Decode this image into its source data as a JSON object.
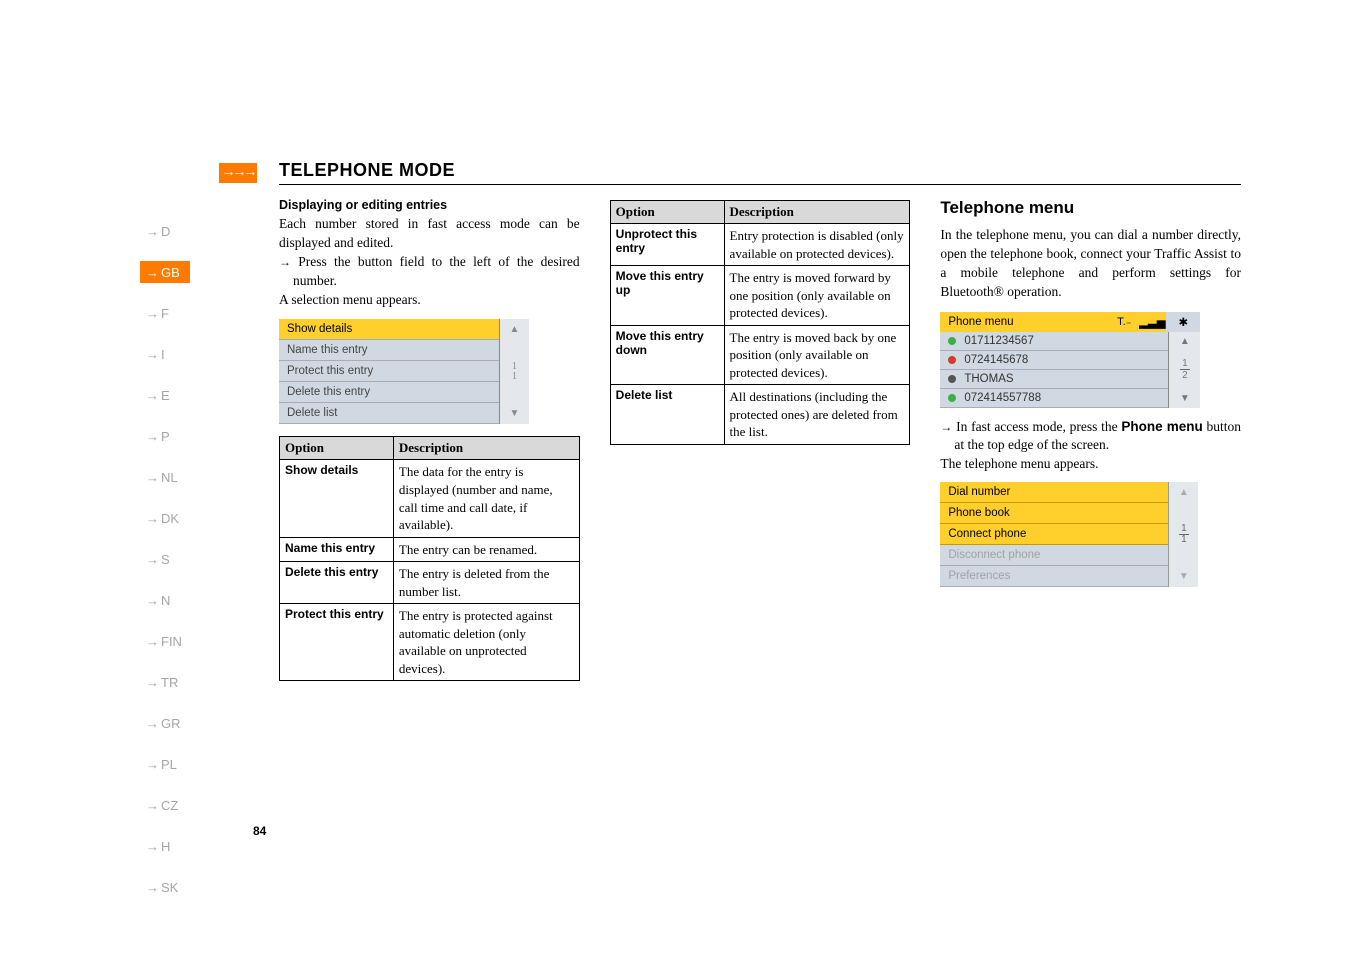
{
  "header": {
    "arrows": "→→→",
    "title": "TELEPHONE MODE"
  },
  "sideNav": [
    "D",
    "GB",
    "F",
    "I",
    "E",
    "P",
    "NL",
    "DK",
    "S",
    "N",
    "FIN",
    "TR",
    "GR",
    "PL",
    "CZ",
    "H",
    "SK"
  ],
  "sideNavActive": "GB",
  "pageNum": "84",
  "col1": {
    "subhead": "Displaying or editing entries",
    "p1": "Each number stored in fast access mode can be displayed and edited.",
    "instr1": "Press the button field to the left of the desired number.",
    "p2": "A selection menu appears.",
    "selMenu": [
      "Show details",
      "Name this entry",
      "Protect this entry",
      "Delete this entry",
      "Delete list"
    ],
    "selMenuSelected": 0,
    "selMenuFrac": "1\n1",
    "table": {
      "headers": [
        "Option",
        "Description"
      ],
      "rows": [
        {
          "opt": "Show details",
          "desc": "The data for the entry is displayed (number and name, call time and call date, if available)."
        },
        {
          "opt": "Name this entry",
          "desc": "The entry can be renamed."
        },
        {
          "opt": "Delete this entry",
          "desc": "The entry is deleted from the number list."
        },
        {
          "opt": "Protect this entry",
          "desc": "The entry is protected against automatic deletion (only available on unprotected devices)."
        }
      ]
    }
  },
  "col2": {
    "table": {
      "headers": [
        "Option",
        "Description"
      ],
      "rows": [
        {
          "opt": "Unprotect this entry",
          "desc": "Entry protection is disabled (only available on protected devices)."
        },
        {
          "opt": "Move this entry up",
          "desc": "The entry is moved forward by one position (only available on protected devices)."
        },
        {
          "opt": "Move this entry down",
          "desc": "The entry is moved back by one position (only available on protected devices)."
        },
        {
          "opt": "Delete list",
          "desc": "All destinations (including the protected ones) are deleted from the list."
        }
      ]
    }
  },
  "col3": {
    "title": "Telephone menu",
    "p1": "In the telephone menu, you can dial a number directly, open the telephone book, connect your Traffic Assist to a mobile telephone and perform settings for Bluetooth® operation.",
    "phoneShot": {
      "title": "Phone menu",
      "btIcon": "✱",
      "frac": [
        "1",
        "2"
      ],
      "rows": [
        {
          "color": "green",
          "text": "01711234567"
        },
        {
          "color": "red",
          "text": "0724145678"
        },
        {
          "color": "grey",
          "text": "THOMAS"
        },
        {
          "color": "green",
          "text": "072414557788"
        }
      ]
    },
    "instr1_a": "In fast access mode, press the ",
    "instr1_bold": "Phone menu",
    "instr1_b": " button at the top edge of the screen.",
    "p2": "The telephone menu appears.",
    "teleMenu": {
      "items": [
        {
          "label": "Dial number",
          "active": true
        },
        {
          "label": "Phone book",
          "active": true
        },
        {
          "label": "Connect phone",
          "active": true
        },
        {
          "label": "Disconnect phone",
          "active": false
        },
        {
          "label": "Preferences",
          "active": false
        }
      ],
      "frac": [
        "1",
        "1"
      ]
    }
  }
}
